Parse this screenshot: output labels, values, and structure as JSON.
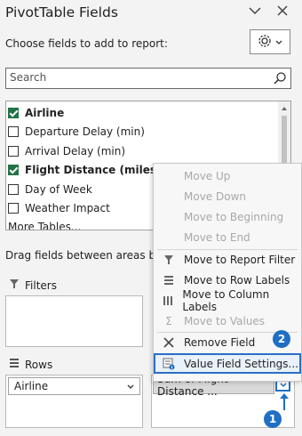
{
  "header": {
    "title": "PivotTable Fields",
    "subtitle": "Choose fields to add to report:"
  },
  "search": {
    "placeholder": "Search"
  },
  "fields": [
    {
      "label": "Airline",
      "checked": true
    },
    {
      "label": "Departure Delay (min)",
      "checked": false
    },
    {
      "label": "Arrival Delay (min)",
      "checked": false
    },
    {
      "label": "Flight Distance (miles)",
      "checked": true
    },
    {
      "label": "Day of Week",
      "checked": false
    },
    {
      "label": "Weather Impact",
      "checked": false
    }
  ],
  "more_tables": "More Tables...",
  "drag_text": "Drag fields between areas belo",
  "areas": {
    "filters_label": "Filters",
    "rows_label": "Rows",
    "rows_item": "Airline",
    "values_item": "Sum of Flight Distance ..."
  },
  "menu": [
    {
      "label": "Move Up",
      "disabled": true,
      "icon": ""
    },
    {
      "label": "Move Down",
      "disabled": true,
      "icon": ""
    },
    {
      "label": "Move to Beginning",
      "disabled": true,
      "icon": ""
    },
    {
      "label": "Move to End",
      "disabled": true,
      "icon": ""
    },
    {
      "label": "Move to Report Filter",
      "disabled": false,
      "icon": "filter-icon"
    },
    {
      "label": "Move to Row Labels",
      "disabled": false,
      "icon": "row-labels-icon"
    },
    {
      "label": "Move to Column Labels",
      "disabled": false,
      "icon": "column-labels-icon"
    },
    {
      "label": "Move to Values",
      "disabled": true,
      "icon": "sigma-icon"
    },
    {
      "label": "Remove Field",
      "disabled": false,
      "icon": "remove-x-icon"
    },
    {
      "label": "Value Field Settings...",
      "disabled": false,
      "icon": "value-settings-icon",
      "highlighted": true
    }
  ],
  "badges": {
    "step1": "1",
    "step2": "2"
  },
  "colors": {
    "accent": "#217346",
    "highlight": "#1f6fc4"
  }
}
